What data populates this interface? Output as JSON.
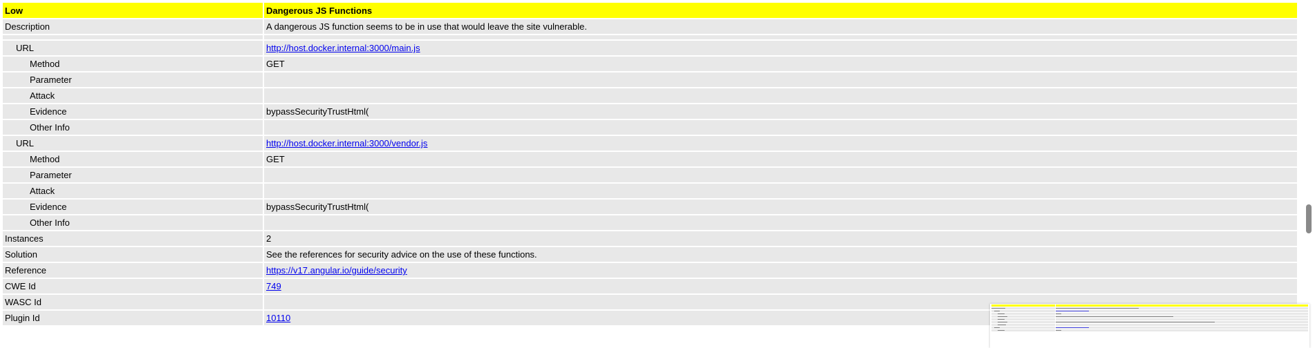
{
  "alert": {
    "risk": "Low",
    "name": "Dangerous JS Functions",
    "description_label": "Description",
    "description": "A dangerous JS function seems to be in use that would leave the site vulnerable.",
    "instances_list": [
      {
        "url_label": "URL",
        "url": "http://host.docker.internal:3000/main.js",
        "method_label": "Method",
        "method": "GET",
        "parameter_label": "Parameter",
        "parameter": "",
        "attack_label": "Attack",
        "attack": "",
        "evidence_label": "Evidence",
        "evidence": "bypassSecurityTrustHtml(",
        "other_label": "Other Info",
        "other": ""
      },
      {
        "url_label": "URL",
        "url": "http://host.docker.internal:3000/vendor.js",
        "method_label": "Method",
        "method": "GET",
        "parameter_label": "Parameter",
        "parameter": "",
        "attack_label": "Attack",
        "attack": "",
        "evidence_label": "Evidence",
        "evidence": "bypassSecurityTrustHtml(",
        "other_label": "Other Info",
        "other": ""
      }
    ],
    "instances_label": "Instances",
    "instances_count": "2",
    "solution_label": "Solution",
    "solution": "See the references for security advice on the use of these functions.",
    "reference_label": "Reference",
    "reference": "https://v17.angular.io/guide/security",
    "cwe_label": "CWE Id",
    "cwe": "749",
    "wasc_label": "WASC Id",
    "wasc": "",
    "plugin_label": "Plugin Id",
    "plugin": "10110"
  },
  "colors": {
    "header_bg": "#ffff00",
    "row_bg": "#e8e8e8",
    "link": "#0000ee"
  }
}
